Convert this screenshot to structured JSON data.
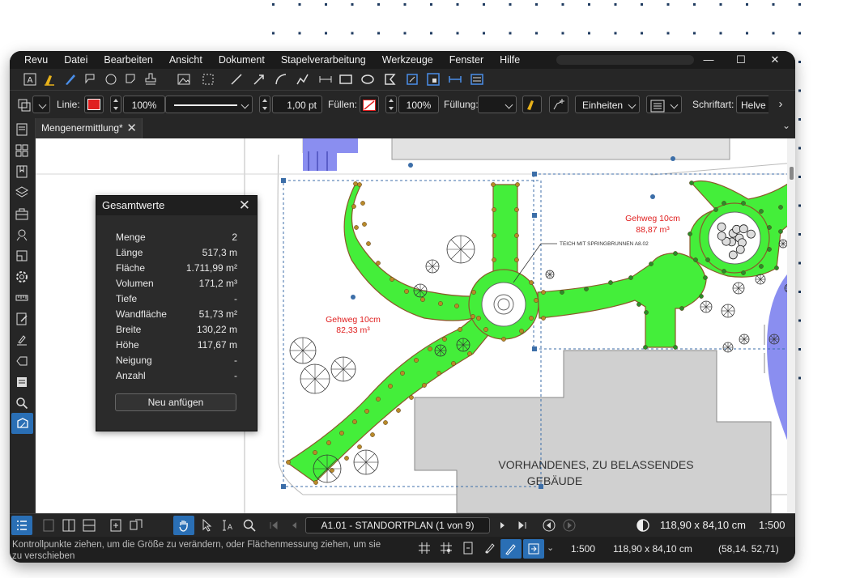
{
  "menu": [
    "Revu",
    "Datei",
    "Bearbeiten",
    "Ansicht",
    "Dokument",
    "Stapelverarbeitung",
    "Werkzeuge",
    "Fenster",
    "Hilfe"
  ],
  "window_controls": {
    "minimize": "—",
    "maximize": "☐",
    "close": "✕"
  },
  "properties_bar": {
    "line_label": "Linie:",
    "line_color": "#e02020",
    "line_opacity": "100%",
    "line_width": "1,00 pt",
    "fill_label": "Füllen:",
    "fill_opacity": "100%",
    "filling_label": "Füllung:",
    "units_label": "Einheiten",
    "font_label": "Schriftart:",
    "font_value": "Helve"
  },
  "tab": {
    "title": "Mengenermittlung*",
    "close": "✕"
  },
  "panel": {
    "title": "Gesamtwerte",
    "close": "✕",
    "rows": [
      {
        "key": "Menge",
        "value": "2"
      },
      {
        "key": "Länge",
        "value": "517,3 m"
      },
      {
        "key": "Fläche",
        "value": "1.711,99 m²"
      },
      {
        "key": "Volumen",
        "value": "171,2 m³"
      },
      {
        "key": "Tiefe",
        "value": "-"
      },
      {
        "key": "Wandfläche",
        "value": "51,73 m²"
      },
      {
        "key": "Breite",
        "value": "130,22 m"
      },
      {
        "key": "Höhe",
        "value": "117,67 m"
      },
      {
        "key": "Neigung",
        "value": "-"
      },
      {
        "key": "Anzahl",
        "value": "-"
      }
    ],
    "button": "Neu anfügen"
  },
  "drawing": {
    "label1_line1": "Gehweg 10cm",
    "label1_line2": "82,33 m³",
    "label2_line1": "Gehweg 10cm",
    "label2_line2": "88,87 m³",
    "pond_label": "TEICH MIT SPRINGBRUNNEN A8.02",
    "building_line1": "VORHANDENES, ZU BELASSENDES",
    "building_line2": "GEBÄUDE",
    "path_color": "#44ee3a",
    "accent": "#3c6ea8"
  },
  "bottom_bar": {
    "page": "A1.01 - STANDORTPLAN (1 von 9)",
    "size": "118,90 x 84,10 cm",
    "scale": "1:500"
  },
  "status_bar": {
    "message": "Kontrollpunkte ziehen, um die Größe zu verändern, oder Flächenmessung ziehen, um sie zu verschieben",
    "scale": "1:500",
    "size": "118,90 x 84,10 cm",
    "coords": "(58,14. 52,71)"
  }
}
